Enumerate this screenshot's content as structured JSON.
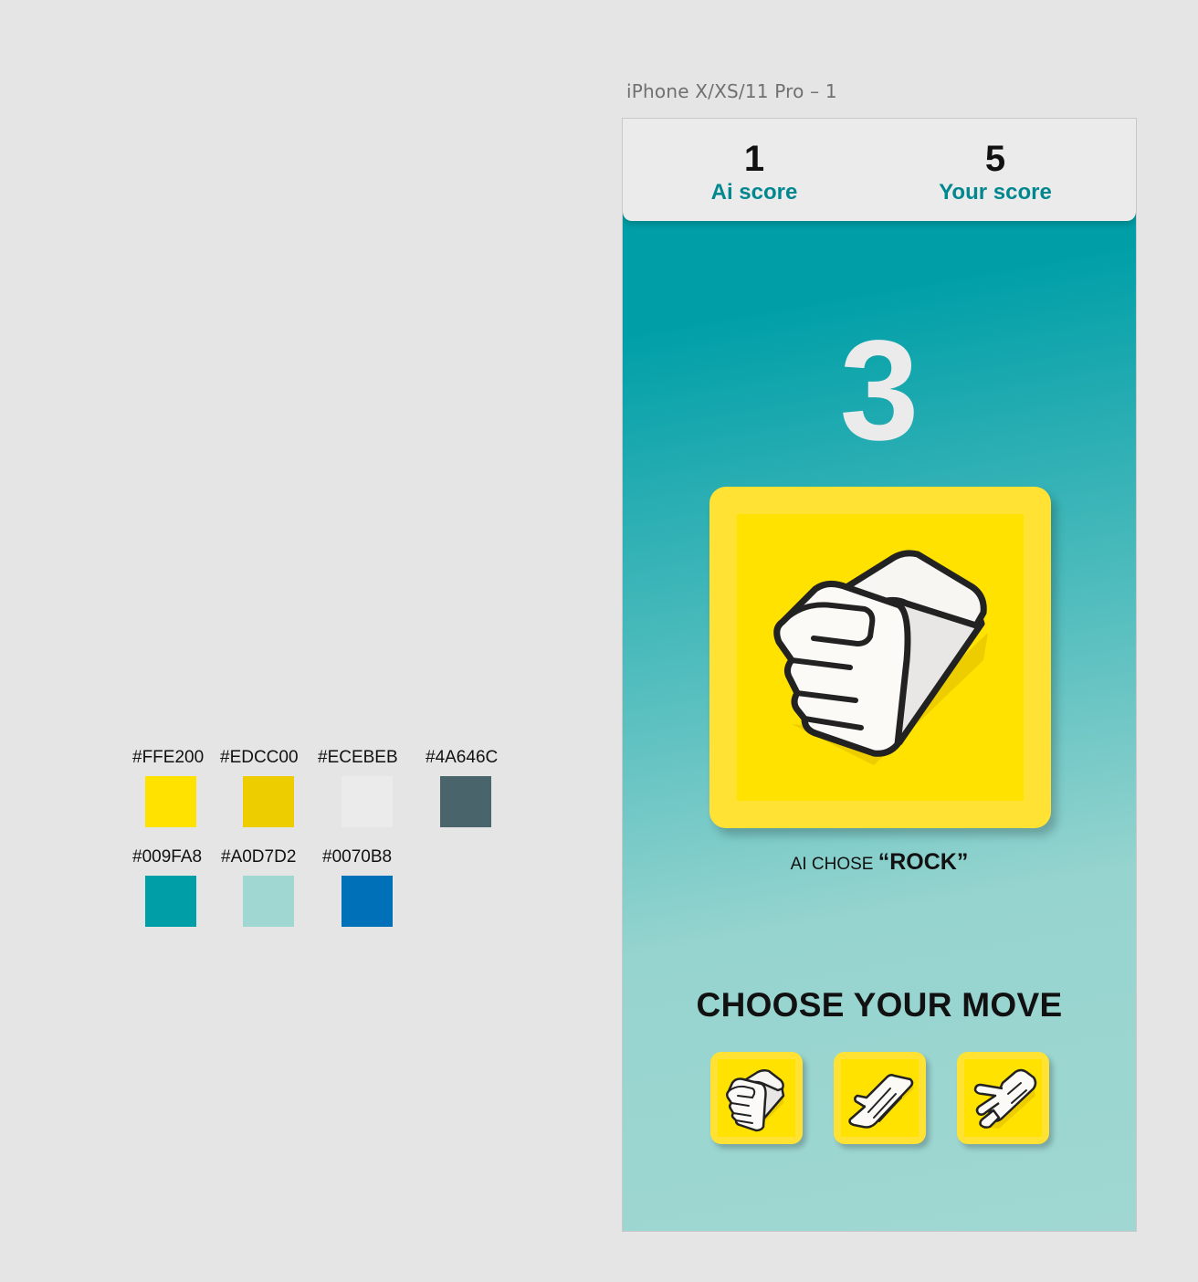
{
  "artboard": {
    "label": "iPhone X/XS/11 Pro – 1"
  },
  "scores": {
    "ai": {
      "value": "1",
      "label": "Ai score"
    },
    "you": {
      "value": "5",
      "label": "Your score"
    }
  },
  "countdown": "3",
  "ai_choice": {
    "prefix": "AI CHOSE",
    "move": "“ROCK”",
    "icon": "rock-hand-icon"
  },
  "prompt": "CHOOSE YOUR MOVE",
  "moves": [
    {
      "name": "rock",
      "icon": "rock-hand-icon"
    },
    {
      "name": "paper",
      "icon": "paper-hand-icon"
    },
    {
      "name": "scissors",
      "icon": "scissors-hand-icon"
    }
  ],
  "palette": [
    {
      "label": "#FFE200",
      "color": "#FFE200"
    },
    {
      "label": "#EDCC00",
      "color": "#EDCC00"
    },
    {
      "label": "#ECEBEB",
      "color": "#ECEBEB"
    },
    {
      "label": "#4A646C",
      "color": "#4A646C"
    },
    {
      "label": "#009FA8",
      "color": "#009FA8"
    },
    {
      "label": "#A0D7D2",
      "color": "#A0D7D2"
    },
    {
      "label": "#0070B8",
      "color": "#0070B8"
    }
  ]
}
